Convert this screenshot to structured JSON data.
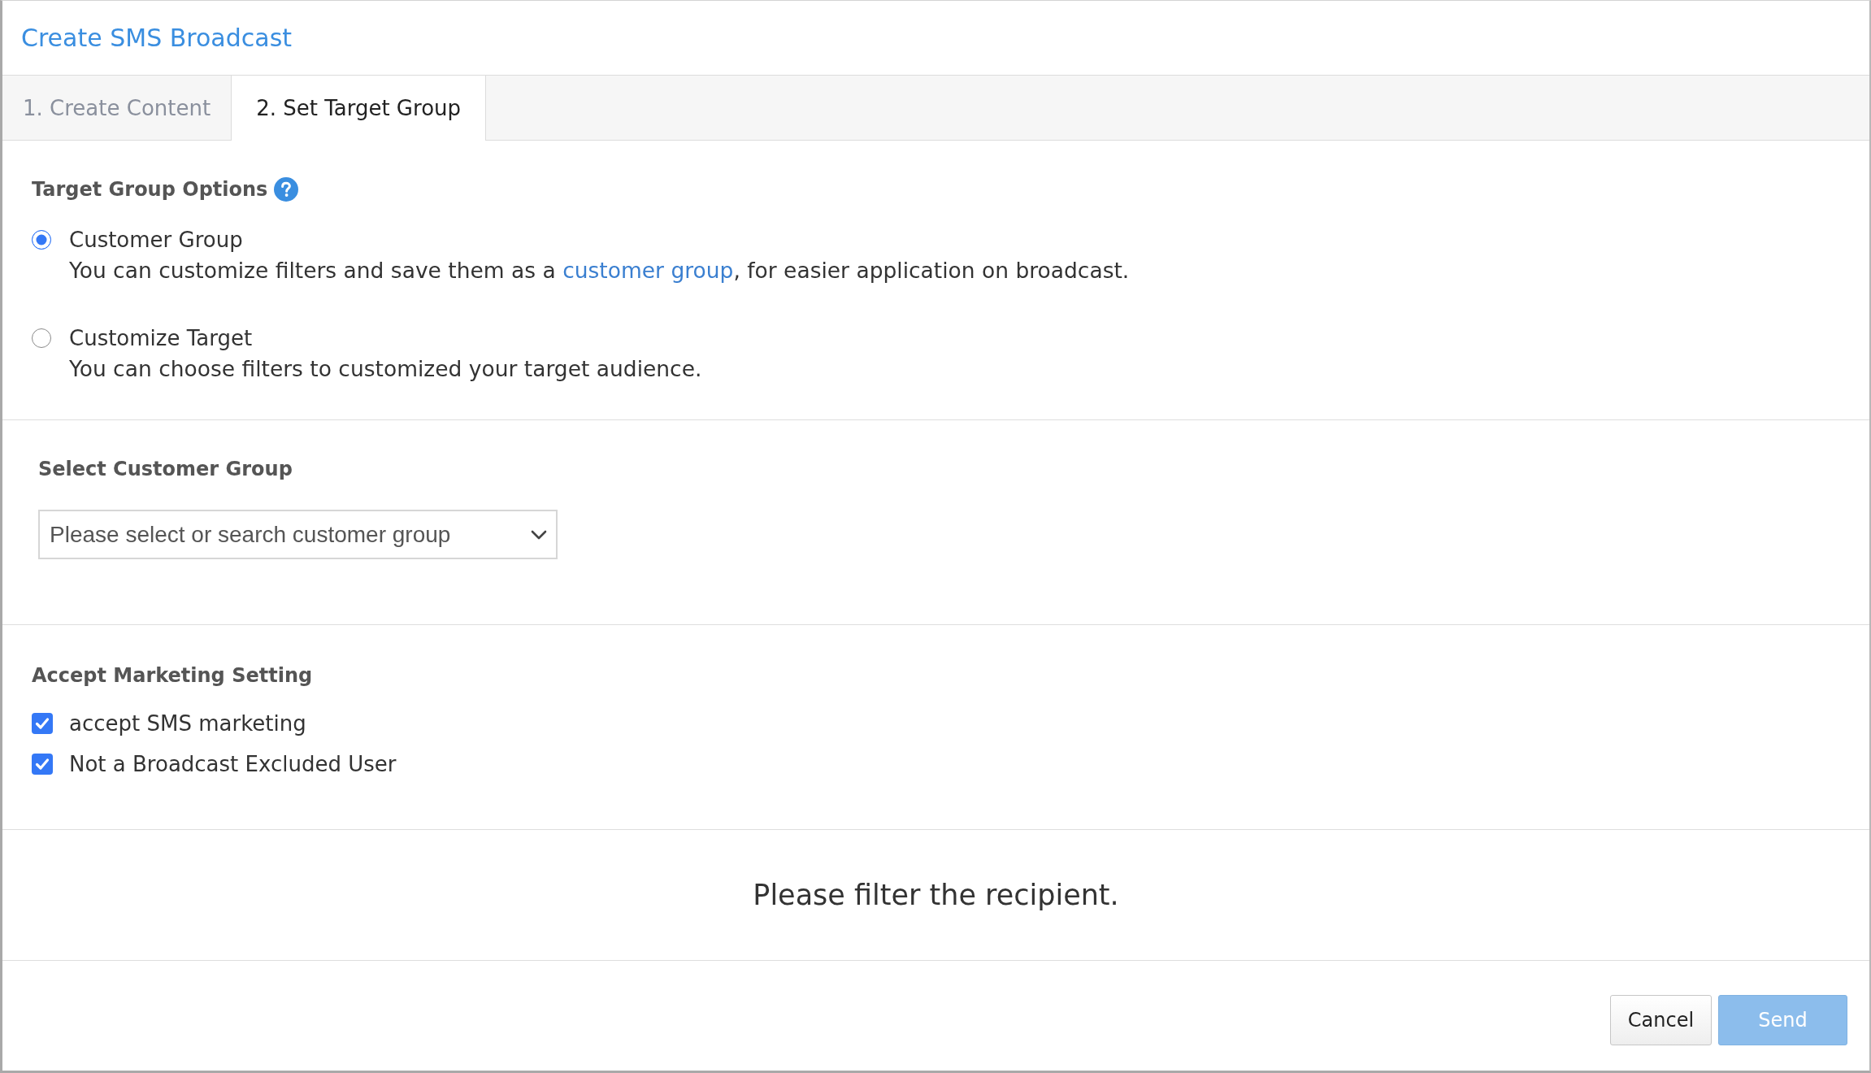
{
  "window": {
    "title": "Create SMS Broadcast"
  },
  "tabs": [
    {
      "label": "1. Create Content",
      "selected": false
    },
    {
      "label": "2. Set Target Group",
      "selected": true
    }
  ],
  "target_group_options": {
    "heading": "Target Group Options",
    "options": [
      {
        "label": "Customer Group",
        "selected": true,
        "description": "You can customize filters and save them as a ",
        "link": "customer group",
        "description_end": ", for easier application on broadcast."
      },
      {
        "label": "Customize Target",
        "selected": false,
        "description": "You can choose filters to customized your target audience."
      }
    ]
  },
  "customer_group_select": {
    "label": "Select Customer Group",
    "placeholder": "Please select or search customer group"
  },
  "marketing_settings": {
    "heading": "Accept Marketing Setting",
    "options": [
      {
        "label": "accept SMS marketing",
        "checked": true
      },
      {
        "label": "Not a Broadcast Excluded User",
        "checked": true
      }
    ]
  },
  "message": "Please filter the recipient.",
  "buttons": [
    {
      "label": "Cancel",
      "kind": "secondary",
      "disabled": false
    },
    {
      "label": "Send",
      "kind": "primary",
      "disabled": true
    }
  ]
}
